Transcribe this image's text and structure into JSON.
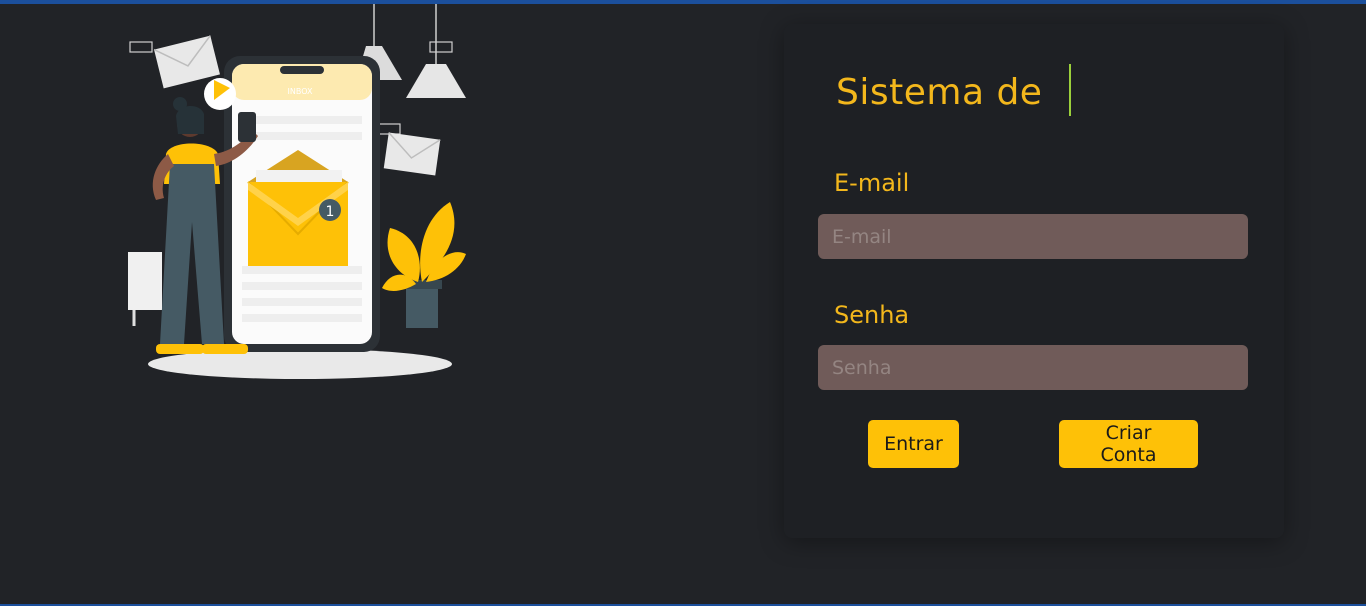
{
  "login": {
    "title": "Sistema de",
    "email_label": "E-mail",
    "email_placeholder": "E-mail",
    "password_label": "Senha",
    "password_placeholder": "Senha",
    "login_button": "Entrar",
    "signup_button": "Criar Conta"
  },
  "illustration": {
    "screen_header": "INBOX",
    "badge_count": "1"
  },
  "colors": {
    "background": "#212327",
    "accent": "#f3b71c",
    "button": "#fec107",
    "input_bg": "#705b59",
    "window_bar": "#1b4f9c"
  }
}
